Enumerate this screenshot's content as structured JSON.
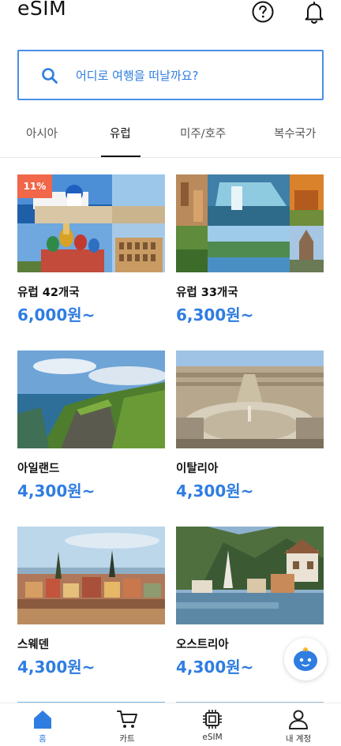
{
  "header": {
    "title": "eSIM",
    "help_icon": "help-circle-icon",
    "bell_icon": "bell-icon"
  },
  "search": {
    "placeholder": "어디로 여행을 떠날까요?",
    "icon": "search-icon"
  },
  "tabs": [
    {
      "label": "아시아",
      "active": false
    },
    {
      "label": "유럽",
      "active": true
    },
    {
      "label": "미주/호주",
      "active": false
    },
    {
      "label": "복수국가",
      "active": false
    }
  ],
  "products": [
    {
      "name": "유럽 42개국",
      "price": "6,000원~",
      "badge": "11%"
    },
    {
      "name": "유럽 33개국",
      "price": "6,300원~"
    },
    {
      "name": "아일랜드",
      "price": "4,300원~"
    },
    {
      "name": "이탈리아",
      "price": "4,300원~"
    },
    {
      "name": "스웨덴",
      "price": "4,300원~"
    },
    {
      "name": "오스트리아",
      "price": "4,300원~"
    }
  ],
  "bottom_nav": [
    {
      "label": "홈",
      "icon": "home-icon",
      "active": true
    },
    {
      "label": "카트",
      "icon": "cart-icon",
      "active": false
    },
    {
      "label": "eSIM",
      "icon": "chip-icon",
      "active": false
    },
    {
      "label": "내 계정",
      "icon": "user-icon",
      "active": false
    }
  ],
  "colors": {
    "accent": "#2f7de1",
    "badge": "#f0674a",
    "search_border": "#4a8fe7"
  }
}
